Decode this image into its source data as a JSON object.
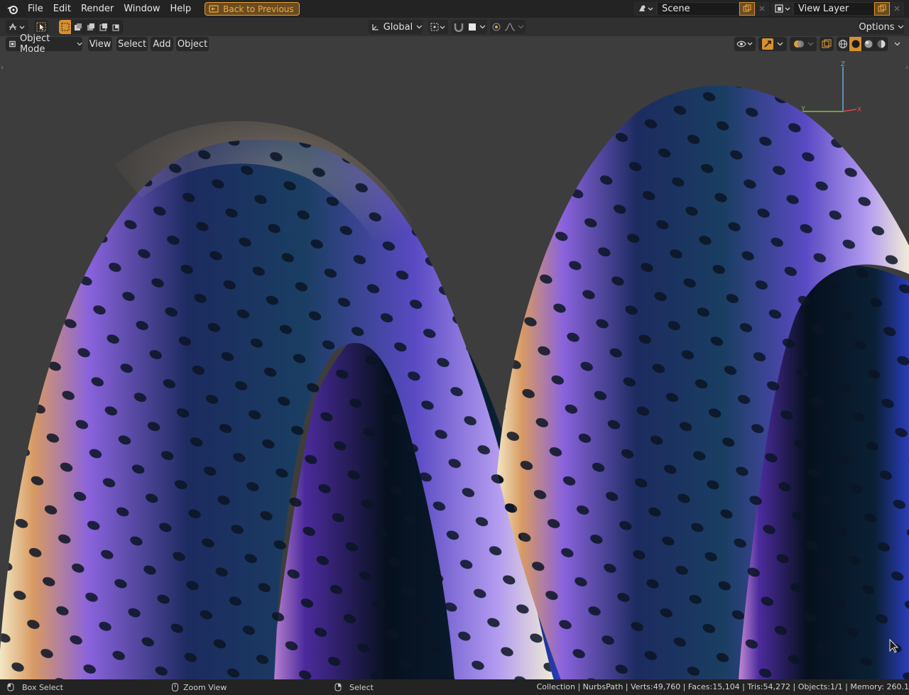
{
  "menu": {
    "items": [
      "File",
      "Edit",
      "Render",
      "Window",
      "Help"
    ],
    "back_button": "Back to Previous"
  },
  "scene": {
    "label": "Scene"
  },
  "view_layer": {
    "label": "View Layer"
  },
  "header_tools": {
    "transform_orientation": "Global",
    "options_label": "Options"
  },
  "viewport_header": {
    "mode": "Object Mode",
    "view": "View",
    "select": "Select",
    "add": "Add",
    "object": "Object"
  },
  "gizmo": {
    "z": "Z",
    "y": "Y",
    "x": "X"
  },
  "statusbar": {
    "left_action": "Box Select",
    "middle_action": "Zoom View",
    "right_action": "Select",
    "stats": "Collection | NurbsPath | Verts:49,760 | Faces:15,104 | Tris:54,272 | Objects:1/1 | Memory: 260.1"
  },
  "colors": {
    "accent": "#d7902f",
    "viewport_bg": "#3d3d3d",
    "header_bg": "#232323"
  }
}
